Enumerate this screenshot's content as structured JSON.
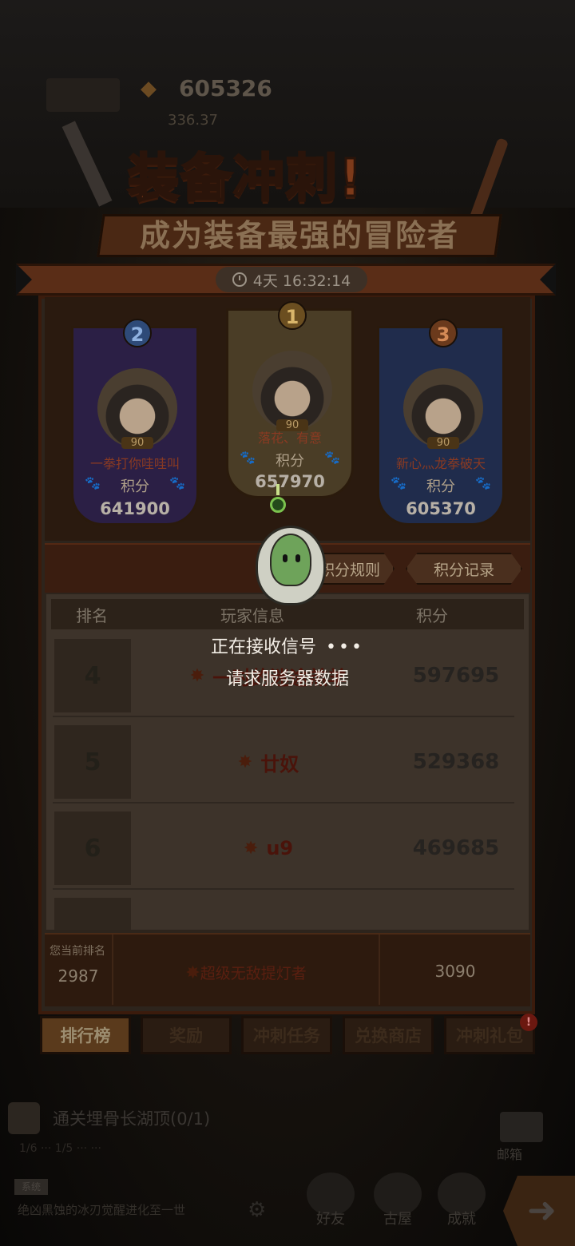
{
  "header": {
    "score": "605326",
    "sub_score": "336.37"
  },
  "event": {
    "title": "装备冲刺!",
    "subtitle": "成为装备最强的冒险者",
    "timer": "4天 16:32:14"
  },
  "podium": [
    {
      "rank": "2",
      "level": "90",
      "name": "一拳打你哇哇叫",
      "label": "积分",
      "score": "641900"
    },
    {
      "rank": "1",
      "level": "90",
      "name": "落花、有意",
      "label": "积分",
      "score": "657970"
    },
    {
      "rank": "3",
      "level": "90",
      "name": "新心灬龙拳破天",
      "label": "积分",
      "score": "605370"
    }
  ],
  "buttons": {
    "rules": "积分规则",
    "record": "积分记录"
  },
  "table": {
    "headers": {
      "rank": "排名",
      "info": "玩家信息",
      "score": "积分"
    },
    "rows": [
      {
        "rank": "4",
        "name": "一时的迷途羔羊",
        "score": "597695"
      },
      {
        "rank": "5",
        "name": "廿奴",
        "score": "529368"
      },
      {
        "rank": "6",
        "name": "u9",
        "score": "469685"
      }
    ]
  },
  "my_rank": {
    "label": "您当前排名",
    "rank": "2987",
    "name": "超级无敌提灯者",
    "score": "3090"
  },
  "tabs": [
    {
      "label": "排行榜"
    },
    {
      "label": "奖励"
    },
    {
      "label": "冲刺任务"
    },
    {
      "label": "兑换商店"
    },
    {
      "label": "冲刺礼包",
      "badge": "!"
    }
  ],
  "hud": {
    "quest": "通关埋骨长湖顶(0/1)",
    "quest_sub": "1/6  ···  1/5  ···  ···",
    "chat_tag": "系统",
    "chat_line": "绝凶黑蚀的冰刃觉醒进化至一世",
    "mail": "邮箱",
    "nav": [
      "好友",
      "古屋",
      "成就"
    ]
  },
  "loading": {
    "line1": "正在接收信号",
    "dots": "•••",
    "line2": "请求服务器数据"
  }
}
